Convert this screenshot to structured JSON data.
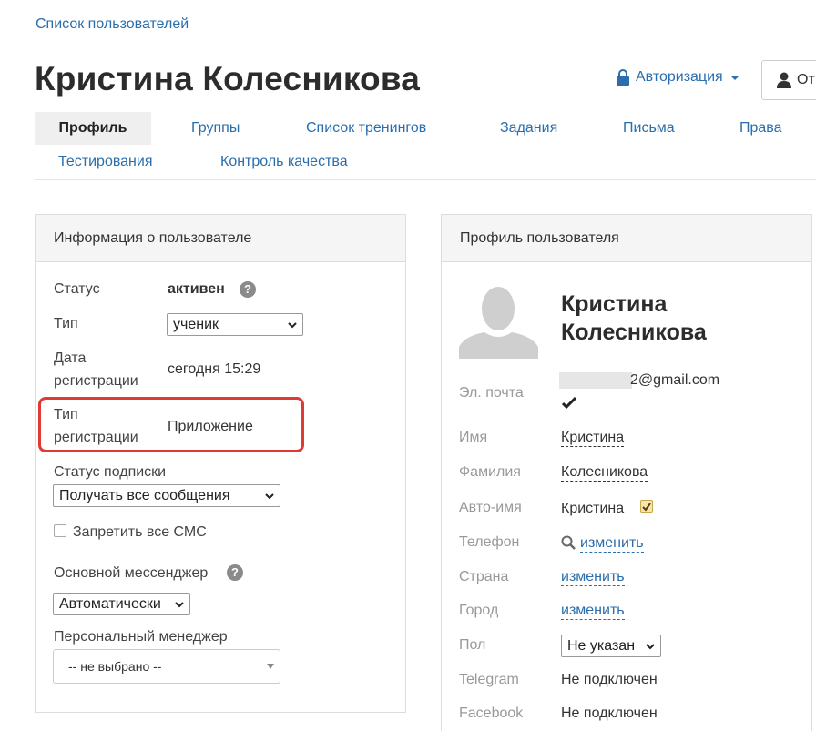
{
  "breadcrumb": {
    "label": "Список пользователей"
  },
  "page": {
    "title": "Кристина Колесникова"
  },
  "auth": {
    "label": "Авторизация"
  },
  "user_button": {
    "label": "От"
  },
  "tabs": [
    {
      "label": "Профиль"
    },
    {
      "label": "Группы"
    },
    {
      "label": "Список тренингов"
    },
    {
      "label": "Задания"
    },
    {
      "label": "Письма"
    },
    {
      "label": "Права"
    },
    {
      "label": "Тестирования"
    },
    {
      "label": "Контроль качества"
    }
  ],
  "user_info": {
    "title": "Информация о пользователе",
    "status_label": "Статус",
    "status_value": "активен",
    "type_label": "Тип",
    "type_value": "ученик",
    "reg_date_label_1": "Дата",
    "reg_date_label_2": "регистрации",
    "reg_date_value": "сегодня 15:29",
    "reg_type_label_1": "Тип",
    "reg_type_label_2": "регистрации",
    "reg_type_value": "Приложение",
    "subscription_label": "Статус подписки",
    "subscription_value": "Получать все сообщения",
    "sms_label": "Запретить все СМС",
    "messenger_label": "Основной мессенджер",
    "messenger_value": "Автоматически",
    "manager_label": "Персональный менеджер",
    "manager_value": "-- не выбрано --"
  },
  "profile": {
    "title": "Профиль пользователя",
    "name_line1": "Кристина",
    "name_line2": "Колесникова",
    "email_label": "Эл. почта",
    "email_value": "2@gmail.com",
    "first_name_label": "Имя",
    "first_name_value": "Кристина",
    "last_name_label": "Фамилия",
    "last_name_value": "Колесникова",
    "auto_name_label": "Авто-имя",
    "auto_name_value": "Кристина",
    "phone_label": "Телефон",
    "phone_value": "изменить",
    "country_label": "Страна",
    "country_value": "изменить",
    "city_label": "Город",
    "city_value": "изменить",
    "gender_label": "Пол",
    "gender_value": "Не указан",
    "telegram_label": "Telegram",
    "telegram_value": "Не подключен",
    "facebook_label": "Facebook",
    "facebook_value": "Не подключен"
  },
  "colors": {
    "link": "#2a6ead",
    "highlight": "#e03a35",
    "checkbox_checked": "#f5e6b0"
  }
}
